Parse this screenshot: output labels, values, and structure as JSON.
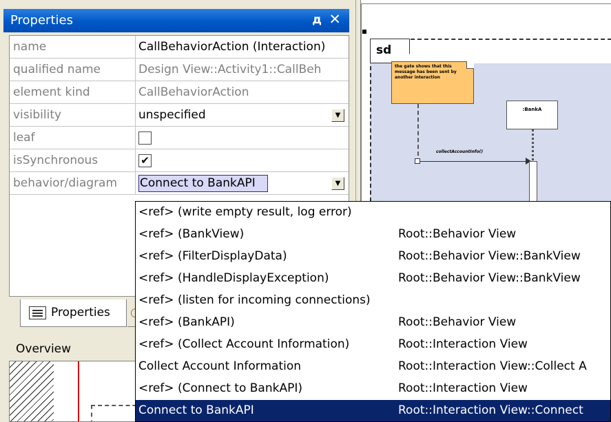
{
  "panel": {
    "title": "Properties",
    "pin_glyph": "д",
    "close_glyph": "✕"
  },
  "properties": [
    {
      "key": "name",
      "value": "CallBehaviorAction (Interaction)"
    },
    {
      "key": "qualified name",
      "value": "Design View::Activity1::CallBeh"
    },
    {
      "key": "element kind",
      "value": "CallBehaviorAction"
    },
    {
      "key": "visibility",
      "value": "unspecified"
    },
    {
      "key": "leaf",
      "value": ""
    },
    {
      "key": "isSynchronous",
      "value": "✔"
    },
    {
      "key": "behavior/diagram",
      "value": "Connect to BankAPI"
    }
  ],
  "tabs": {
    "properties_label": "Properties"
  },
  "overview": {
    "title": "Overview"
  },
  "diagram": {
    "frame_label": "sd",
    "note_text": "the gate shows that this message has been sent by another interaction",
    "lifeline_label": ":BankA",
    "message_label": "collectAccountInfo()"
  },
  "dropdown": {
    "options": [
      {
        "label": "<ref> (write empty result, log error)",
        "path": ""
      },
      {
        "label": "<ref> (BankView)",
        "path": "Root::Behavior View"
      },
      {
        "label": "<ref> (FilterDisplayData)",
        "path": "Root::Behavior View::BankView"
      },
      {
        "label": "<ref> (HandleDisplayException)",
        "path": "Root::Behavior View::BankView"
      },
      {
        "label": "<ref> (listen for incoming connections)",
        "path": ""
      },
      {
        "label": "<ref> (BankAPI)",
        "path": "Root::Behavior View"
      },
      {
        "label": "<ref> (Collect Account Information)",
        "path": "Root::Interaction View"
      },
      {
        "label": "Collect Account Information",
        "path": "Root::Interaction View::Collect A"
      },
      {
        "label": "<ref> (Connect to BankAPI)",
        "path": "Root::Interaction View"
      },
      {
        "label": "Connect to BankAPI",
        "path": "Root::Interaction View::Connect"
      }
    ],
    "selected_index": 9
  },
  "colors": {
    "title_bar": "#0058c8",
    "selection": "#0a246a",
    "note_fill": "#ffc870",
    "frame_fill": "#d6dbee",
    "overview_viewport": "#d60000"
  }
}
